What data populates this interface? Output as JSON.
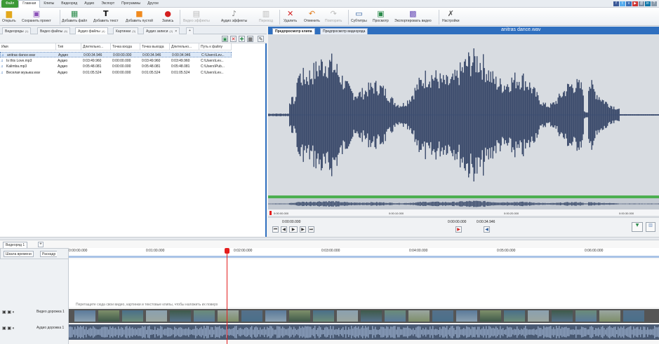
{
  "menu": {
    "file": "Файл",
    "items": [
      "Главная",
      "Клипы",
      "Видеоряд",
      "Аудио",
      "Экспорт",
      "Программы",
      "Другое"
    ]
  },
  "toolbar": {
    "open": "Открыть",
    "save_project": "Сохранить проект",
    "add_file": "Добавить файл",
    "add_text": "Добавить текст",
    "add_blank": "Добавить пустой",
    "record": "Запись",
    "video_effects": "Видео эффекты",
    "audio_effects": "Аудио эффекты",
    "transition": "Переход",
    "delete": "Удалить",
    "undo": "Отменить",
    "redo": "Повторить",
    "subtitles": "Субтитры",
    "preview": "Просмотр",
    "export_video": "Экспортировать видео",
    "settings": "Настройки"
  },
  "tabs": [
    {
      "label": "Видеоряды",
      "count": "(1)"
    },
    {
      "label": "Видео файлы",
      "count": "(6)"
    },
    {
      "label": "Аудио файлы",
      "count": "(4)"
    },
    {
      "label": "Картинки",
      "count": "(3)"
    },
    {
      "label": "Аудио записи",
      "count": "(2)"
    }
  ],
  "add_tab": "+",
  "close_tab": "×",
  "file_table": {
    "headers": [
      "Имя",
      "Тип",
      "Длительно...",
      "Точка входа",
      "Точка выхода",
      "Длительно...",
      "Путь к файлу"
    ],
    "rows": [
      [
        "anitras dance.wav",
        "Аудио",
        "0:00:34.946",
        "0:00:00.000",
        "0:00:34.946",
        "0:00:34.946",
        "C:\\Users\\Lev..."
      ],
      [
        "Is this Love.mp3",
        "Аудио",
        "0:03:49.960",
        "0:00:00.000",
        "0:03:49.960",
        "0:03:49.960",
        "C:\\Users\\Lev..."
      ],
      [
        "Kalimba.mp3",
        "Аудио",
        "0:05:48.081",
        "0:00:00.000",
        "0:05:48.081",
        "0:05:48.081",
        "C:\\Users\\Pub..."
      ],
      [
        "Веселая музыка.wav",
        "Аудио",
        "0:01:05.524",
        "0:00:00.000",
        "0:01:05.524",
        "0:01:05.524",
        "C:\\Users\\Lev..."
      ]
    ]
  },
  "preview": {
    "tab_clip": "Предпросмотр клипа",
    "tab_video": "Предпросмотр видеоряда",
    "clip_title": "anitras dance.wav",
    "mini_ticks": [
      "0:00:00.000",
      "0:00:10.000",
      "0:00:20.000",
      "0:00:30.000"
    ],
    "current_time": "0:00:00.000",
    "in_time": "0:00:00.000",
    "out_time": "0:00:34.946"
  },
  "timeline": {
    "tab": "Видеоряд 1",
    "add_tab": "+",
    "header_timeline": "Шкала времени",
    "header_storyboard": "Раскадр",
    "ruler": [
      "0:00:00.000",
      "0:01:00.000",
      "0:02:00.000",
      "0:03:00.000",
      "0:04:00.000",
      "0:05:00.000",
      "0:06:00.000"
    ],
    "hint": "Перетащите сюда свои видео, картинки и текстовые клипы, чтобы наложить их поверх",
    "video_track": "Видео дорожка 1",
    "audio_track": "Аудио дорожка 1"
  },
  "colors": {
    "accent": "#2f6fbf",
    "waveform": "#3a4a6b",
    "playhead": "#e41e1e",
    "file_menu": "#3c9a37",
    "waveform_bg": "#d8dce1"
  },
  "icons": {
    "open": "folder-icon",
    "save": "floppy-icon",
    "add_file": "film-plus-icon",
    "add_text": "text-t-icon",
    "add_blank": "blank-page-icon",
    "record": "record-dot-icon",
    "delete": "red-x-icon",
    "undo": "undo-arrow-icon",
    "redo": "redo-arrow-icon",
    "settings": "wrench-icon"
  }
}
